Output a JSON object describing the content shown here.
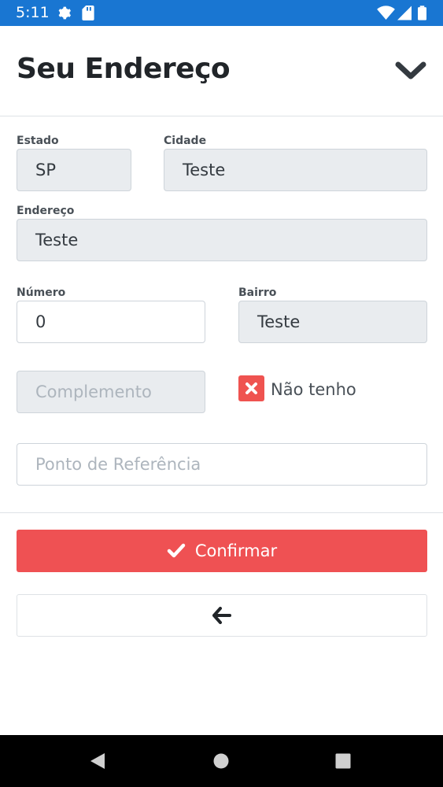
{
  "status_bar": {
    "time": "5:11"
  },
  "header": {
    "title": "Seu Endereço"
  },
  "form": {
    "estado": {
      "label": "Estado",
      "value": "SP"
    },
    "cidade": {
      "label": "Cidade",
      "value": "Teste"
    },
    "endereco": {
      "label": "Endereço",
      "value": "Teste"
    },
    "numero": {
      "label": "Número",
      "value": "0"
    },
    "bairro": {
      "label": "Bairro",
      "value": "Teste"
    },
    "complemento": {
      "placeholder": "Complemento"
    },
    "nao_tenho": {
      "label": "Não tenho"
    },
    "ponto_referencia": {
      "placeholder": "Ponto de Referência"
    }
  },
  "actions": {
    "confirm_label": "Confirmar"
  },
  "colors": {
    "status_bar": "#1976d2",
    "accent": "#ef5153",
    "readonly_bg": "#e9ecef"
  }
}
